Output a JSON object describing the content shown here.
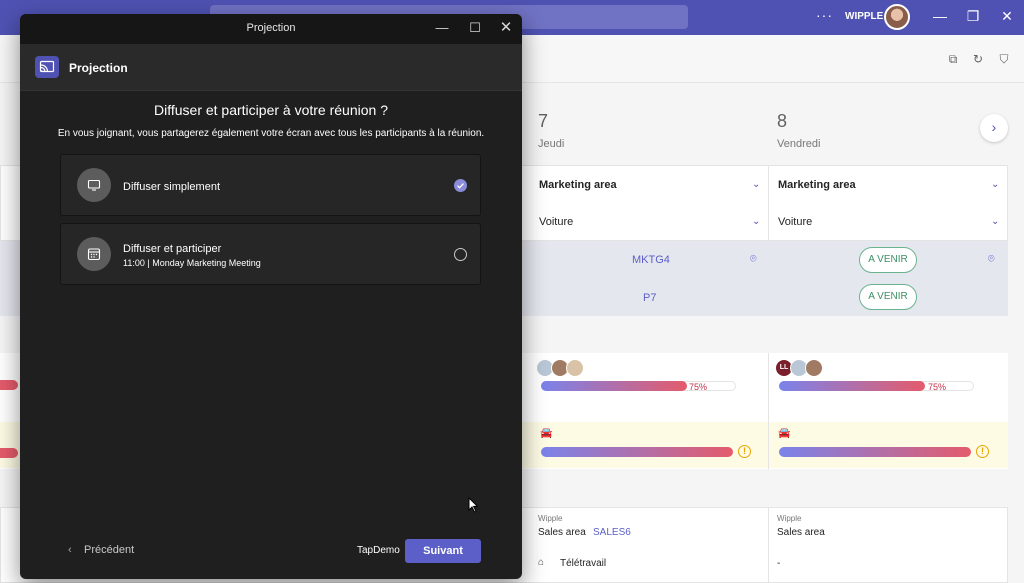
{
  "background": {
    "user_label": "WIPPLE",
    "days": [
      {
        "num": "7",
        "name": "Jeudi"
      },
      {
        "num": "8",
        "name": "Vendredi"
      }
    ],
    "area_select": "Marketing area",
    "transport_select": "Voiture",
    "room": "MKTG4",
    "parking": "P7",
    "status": "A VENIR",
    "occupancy": "75%",
    "occupancy_fraction": 0.75,
    "initials": "LL",
    "company": "Wipple",
    "sales_area": "Sales area",
    "sales_room": "SALES6",
    "remote": "Télétravail",
    "dash": "-"
  },
  "dialog": {
    "window_title": "Projection",
    "app_name": "Projection",
    "question": "Diffuser et participer à votre réunion ?",
    "description": "En vous joignant, vous partagerez également votre écran avec tous les participants à la réunion.",
    "options": [
      {
        "title": "Diffuser simplement",
        "subtitle": "",
        "selected": true
      },
      {
        "title": "Diffuser et participer",
        "subtitle": "11:00 | Monday Marketing Meeting",
        "selected": false
      }
    ],
    "back_label": "Précédent",
    "tenant_label": "TapDemo",
    "next_label": "Suivant"
  },
  "colors": {
    "teams_purple": "#4f52b2",
    "accent": "#5b5fc7",
    "dialog_bg": "#1f1f1f"
  }
}
